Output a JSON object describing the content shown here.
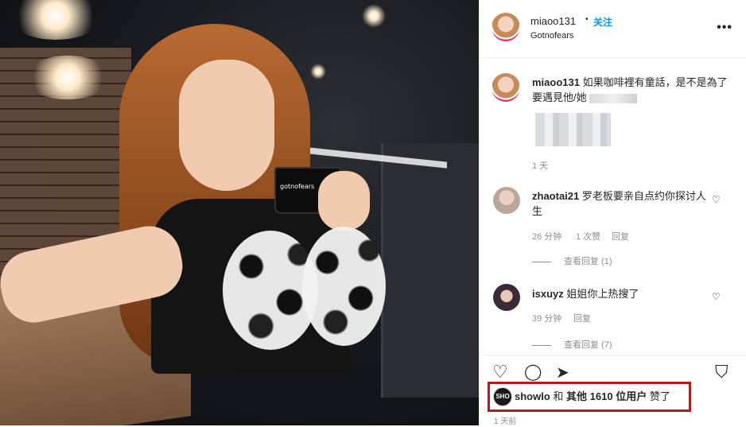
{
  "post": {
    "username": "miaoo131",
    "separator": "•",
    "follow_label": "关注",
    "location": "Gotnofears",
    "more_label": "•••"
  },
  "caption": {
    "username": "miaoo131",
    "text": "如果咖啡裡有童話，是不是為了要遇見他/她",
    "time": "1 天"
  },
  "mug_text": "gotnofears",
  "comments": [
    {
      "username": "zhaotai21",
      "text": "罗老板要亲自点约你探讨人生",
      "time": "26 分钟",
      "likes": "1 次赞",
      "reply_label": "回复",
      "view_replies": "查看回复 (1)"
    },
    {
      "username": "isxuyz",
      "text": "姐姐你上热搜了",
      "time": "39 分钟",
      "reply_label": "回复",
      "view_replies": "查看回复 (7)"
    }
  ],
  "likes_row": {
    "avatar_text": "SHO",
    "liker": "showlo",
    "and": "和",
    "others": "其他 1610 位用户",
    "suffix": "赞了"
  },
  "footer_time": "1 天前",
  "icons": {
    "heart": "♡",
    "comment": "◯",
    "share": "➤",
    "bookmark": "⛉"
  }
}
